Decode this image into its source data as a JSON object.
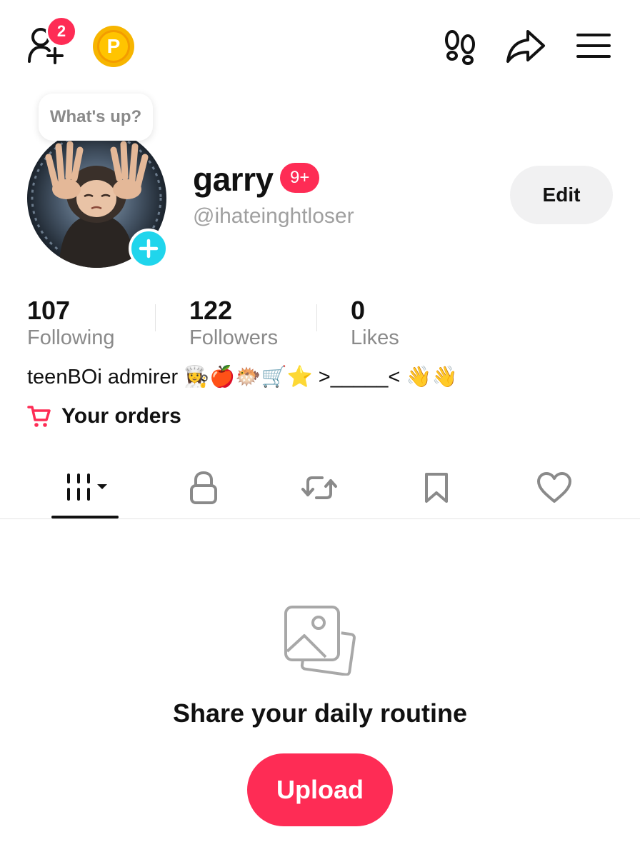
{
  "topbar": {
    "add_friends_badge": "2",
    "coin_letter": "P"
  },
  "profile": {
    "bubble_text": "What's up?",
    "name": "garry",
    "name_badge": "9+",
    "handle": "@ihateinghtloser",
    "edit_label": "Edit"
  },
  "stats": [
    {
      "value": "107",
      "label": "Following"
    },
    {
      "value": "122",
      "label": "Followers"
    },
    {
      "value": "0",
      "label": "Likes"
    }
  ],
  "bio": "teenBOi admirer 👩‍🍳🍎🐡🛒⭐ >_____< 👋👋",
  "orders_label": "Your orders",
  "tabs": [
    "videos",
    "private",
    "reposts",
    "favorites",
    "liked"
  ],
  "empty_state": {
    "title": "Share your daily routine",
    "upload_label": "Upload"
  },
  "colors": {
    "accent": "#fe2c55",
    "plus": "#20d5ec",
    "coin": "#f7b500"
  }
}
